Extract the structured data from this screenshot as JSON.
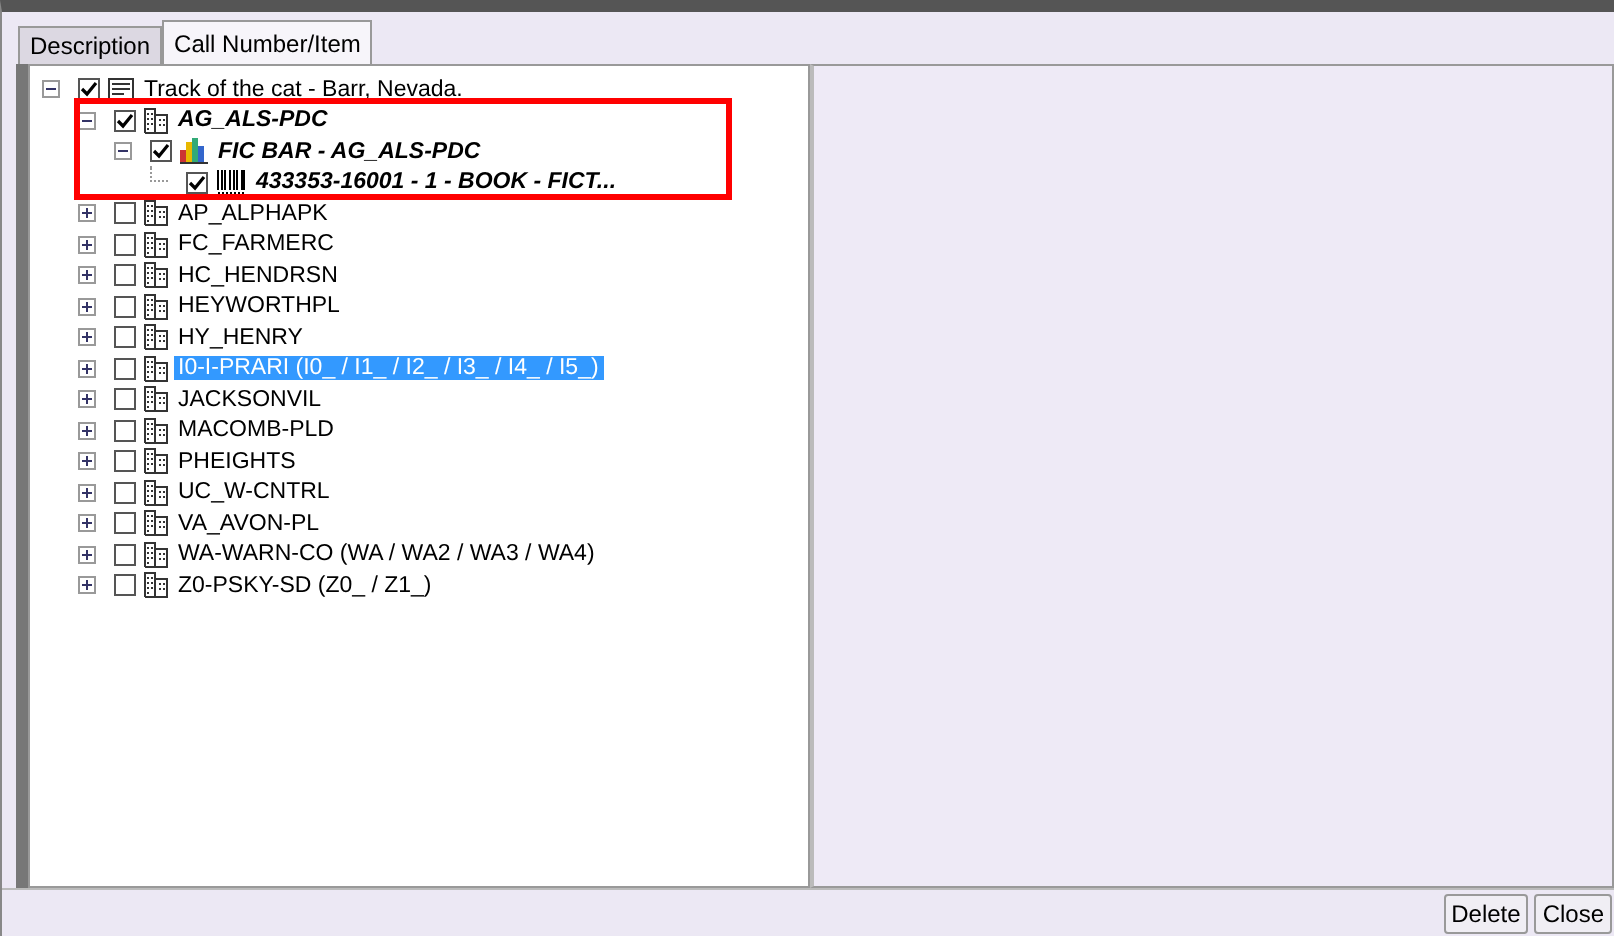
{
  "tabs": [
    {
      "label": "Description",
      "selected": false
    },
    {
      "label": "Call Number/Item",
      "selected": true
    }
  ],
  "tree": [
    {
      "label": "Track of the cat - Barr, Nevada.",
      "kind": "record",
      "checked": true,
      "expanded": true,
      "emphasized": false,
      "selected": false,
      "children": [
        {
          "label": "AG_ALS-PDC",
          "kind": "library",
          "checked": true,
          "expanded": true,
          "emphasized": true,
          "selected": false,
          "children": [
            {
              "label": "FIC BAR - AG_ALS-PDC",
              "kind": "callnumber",
              "checked": true,
              "expanded": true,
              "emphasized": true,
              "selected": false,
              "children": [
                {
                  "label": "433353-16001 - 1 - BOOK - FICT...",
                  "kind": "item",
                  "checked": true,
                  "emphasized": true,
                  "selected": false
                }
              ]
            }
          ]
        },
        {
          "label": "AP_ALPHAPK",
          "kind": "library",
          "checked": false,
          "expanded": false,
          "emphasized": false,
          "selected": false
        },
        {
          "label": "FC_FARMERC",
          "kind": "library",
          "checked": false,
          "expanded": false,
          "emphasized": false,
          "selected": false
        },
        {
          "label": "HC_HENDRSN",
          "kind": "library",
          "checked": false,
          "expanded": false,
          "emphasized": false,
          "selected": false
        },
        {
          "label": "HEYWORTHPL",
          "kind": "library",
          "checked": false,
          "expanded": false,
          "emphasized": false,
          "selected": false
        },
        {
          "label": "HY_HENRY",
          "kind": "library",
          "checked": false,
          "expanded": false,
          "emphasized": false,
          "selected": false
        },
        {
          "label": "I0-I-PRARI (I0_ / I1_ / I2_ / I3_ / I4_ / I5_)",
          "kind": "library",
          "checked": false,
          "expanded": false,
          "emphasized": false,
          "selected": true
        },
        {
          "label": "JACKSONVIL",
          "kind": "library",
          "checked": false,
          "expanded": false,
          "emphasized": false,
          "selected": false
        },
        {
          "label": "MACOMB-PLD",
          "kind": "library",
          "checked": false,
          "expanded": false,
          "emphasized": false,
          "selected": false
        },
        {
          "label": "PHEIGHTS",
          "kind": "library",
          "checked": false,
          "expanded": false,
          "emphasized": false,
          "selected": false
        },
        {
          "label": "UC_W-CNTRL",
          "kind": "library",
          "checked": false,
          "expanded": false,
          "emphasized": false,
          "selected": false
        },
        {
          "label": "VA_AVON-PL",
          "kind": "library",
          "checked": false,
          "expanded": false,
          "emphasized": false,
          "selected": false
        },
        {
          "label": "WA-WARN-CO (WA / WA2 / WA3 / WA4)",
          "kind": "library",
          "checked": false,
          "expanded": false,
          "emphasized": false,
          "selected": false
        },
        {
          "label": "Z0-PSKY-SD (Z0_ / Z1_)",
          "kind": "library",
          "checked": false,
          "expanded": false,
          "emphasized": false,
          "selected": false
        }
      ]
    }
  ],
  "buttons": [
    {
      "label": "Delete"
    },
    {
      "label": "Close"
    }
  ]
}
